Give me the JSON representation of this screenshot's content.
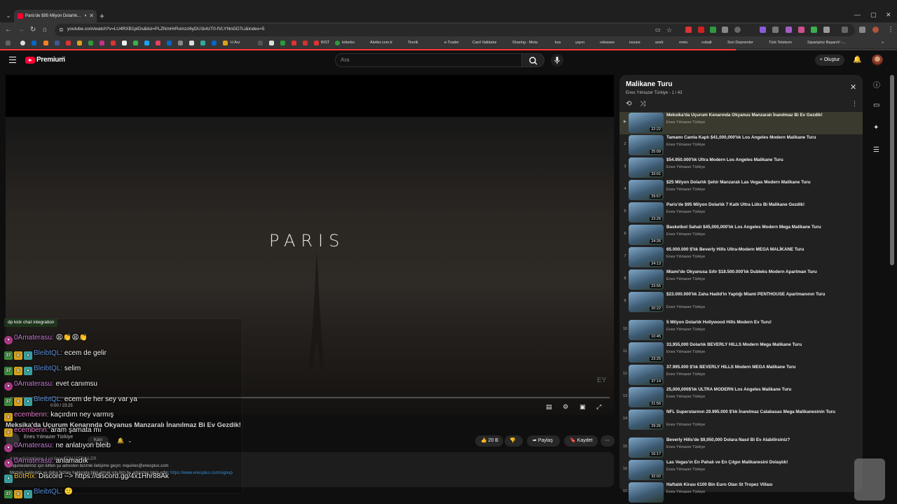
{
  "browser": {
    "tab_title": "Paris'de $95 Milyon Dolarlık...",
    "url": "youtube.com/watch?v=LU4RXB1pIDs&list=PLZNmHrRomzz6yDU1k4zT0-fVLYNnGD7Li&index=5",
    "bookmarks": [
      "H Arz",
      "BIST",
      "letterbx",
      "Aletler.com.tr",
      "Teorik",
      "e-Trader",
      "Card Validator",
      "Sharing - Meta",
      "kss",
      "yayın",
      "releases",
      "issues",
      "work",
      "mmo",
      "cobalt",
      "Son Depremler",
      "Türk Telekom",
      "Siparişiniz Başarılı! -..."
    ]
  },
  "header": {
    "brand": "Premium",
    "country": "TR",
    "search_placeholder": "Ara",
    "create_label": "Oluştur"
  },
  "video": {
    "overlay_title": "PARIS",
    "time": "0:00 / 23:25",
    "watermark": "EY"
  },
  "chat": {
    "header": "dp kick chat integration",
    "messages": [
      {
        "user": "0Amaterasu:",
        "text": "😩👏😩👏",
        "color": "#c77bd6",
        "badges": [
          "p"
        ],
        "id": 0
      },
      {
        "user": "BleibtQL:",
        "text": "ecem de gelir",
        "color": "#5b8fd6",
        "badges": [
          "k",
          "y",
          "g"
        ],
        "id": 1
      },
      {
        "user": "BleibtQL:",
        "text": "selim",
        "color": "#5b8fd6",
        "badges": [
          "k",
          "y",
          "g"
        ],
        "id": 2
      },
      {
        "user": "0Amaterasu:",
        "text": "evet canımsu",
        "color": "#c77bd6",
        "badges": [
          "p"
        ],
        "id": 3
      },
      {
        "user": "BleibtQL:",
        "text": "ecem de her sey var ya",
        "color": "#5b8fd6",
        "badges": [
          "k",
          "y",
          "g"
        ],
        "id": 4
      },
      {
        "user": "ecembenn:",
        "text": "kaçırdım ney varmış",
        "color": "#e07cc5",
        "badges": [
          "y"
        ],
        "id": 5
      },
      {
        "user": "ecembenn:",
        "text": "aram şamata mı",
        "color": "#e07cc5",
        "badges": [
          "y"
        ],
        "id": 6
      },
      {
        "user": "0Amaterasu:",
        "text": "ne anlatıyon bleib",
        "color": "#c77bd6",
        "badges": [
          "p"
        ],
        "id": 7
      },
      {
        "user": "0Amaterasu:",
        "text": "anlamadık",
        "color": "#c77bd6",
        "badges": [
          "p"
        ],
        "id": 8
      },
      {
        "user": "BotRix:",
        "text": "Discord --> https://discord.gg/4x1Hhr88Ak",
        "color": "#f0c040",
        "badges": [
          "g"
        ],
        "id": 9
      },
      {
        "user": "BleibtQL:",
        "text": "🙂",
        "color": "#5b8fd6",
        "badges": [
          "k",
          "y",
          "g"
        ],
        "id": 10
      }
    ]
  },
  "watch": {
    "title": "Meksika'da Uçurum Kenarında Okyanus Manzaralı İnanılmaz Bi Ev Gezdik!",
    "channel": "Enes Yılmazer Türkiye",
    "join": "Katıl",
    "likes": "20 B",
    "share": "Paylaş",
    "save": "Kaydet",
    "desc_line1": "4 Mn görüntüleme  4 yıl önce  TÜM İÇERİKLER",
    "desc_line2": "inquiriesleriniz için lütfen şu adresten bizimle iletişime geçin: inquiries@enesplus.com",
    "desc_line3": "Mortals hakkında ve daha fazlası hakkında bilgi almak için bizi bu adresten takip edin: ",
    "desc_link": "https://www.enesplus.com/signup"
  },
  "playlist": {
    "title": "Malikane Turu",
    "subtitle": "Enes Yılmazer Türkiye - 1 / 43",
    "items": [
      {
        "idx": "▶",
        "title": "Meksika'da Uçurum Kenarında Okyanus Manzaralı İnanılmaz Bi Ev Gezdik!",
        "channel": "Enes Yılmazer Türkiye",
        "duration": "22:22"
      },
      {
        "idx": "2",
        "title": "Tamamı Camla Kaplı $41,000,000'lık Los Angeles Modern Malikane Turu",
        "channel": "Enes Yılmazer Türkiye",
        "duration": "25:09"
      },
      {
        "idx": "3",
        "title": "$54.950.000'lık Ultra Modern Los Angeles Malikane Turu",
        "channel": "Enes Yılmazer Türkiye",
        "duration": "33:01"
      },
      {
        "idx": "4",
        "title": "$25 Milyon Dolarlık Şehir Manzaralı Las Vegas Modern Malikane Turu",
        "channel": "Enes Yılmazer Türkiye",
        "duration": "29:57"
      },
      {
        "idx": "5",
        "title": "Paris'de $95 Milyon Dolarlık 7 Katlı Ultra Lüks Bi Malikane Gezdik!",
        "channel": "Enes Yılmazer Türkiye",
        "duration": "23:26"
      },
      {
        "idx": "6",
        "title": "Basketbol Sahalı $45,000,000'lık Los Angeles Modern Mega Malikane Turu",
        "channel": "Enes Yılmazer Türkiye",
        "duration": "24:26"
      },
      {
        "idx": "7",
        "title": "65.000.000 $'lık Beverly Hills Ultra-Modern MEGA MALİKANE Turu",
        "channel": "Enes Yılmazer Türkiye",
        "duration": "24:13"
      },
      {
        "idx": "8",
        "title": "Miami'de Okyanusa Sıfır $18.500.000'lık Dubleks Modern Apartman Turu",
        "channel": "Enes Yılmazer Türkiye",
        "duration": "23:55"
      },
      {
        "idx": "9",
        "title": "$23.000.000'lık Zaha Hadid'in Yaptığı Miami PENTHOUSE Apartmanının Turu",
        "channel": "Enes Yılmazer Türkiye",
        "duration": "20:22"
      },
      {
        "idx": "10",
        "title": "5 Milyon Dolarlık Hollywood Hills Modern Ev Turu!",
        "channel": "Enes Yılmazer Türkiye",
        "duration": "10:45"
      },
      {
        "idx": "11",
        "title": "33,955,000 Dolarlık BEVERLY HILLS Modern Mega Malikane Turu",
        "channel": "Enes Yılmazer Türkiye",
        "duration": "23:25"
      },
      {
        "idx": "12",
        "title": "37.995.000 $'lık BEVERLY HILLS Modern MEGA Malikane Turu",
        "channel": "Enes Yılmazer Türkiye",
        "duration": "37:14"
      },
      {
        "idx": "13",
        "title": "25,000,000$'lık ULTRA MODERN Los Angeles Malikane Turu",
        "channel": "Enes Yılmazer Türkiye",
        "duration": "21:50"
      },
      {
        "idx": "14",
        "title": "NFL Superstarının 29.995.000 $'lık İnanılmaz Calabasas Mega Malikanesinin Turu",
        "channel": "Enes Yılmazer Türkiye",
        "duration": "29:26"
      },
      {
        "idx": "15",
        "title": "Beverly Hills'de $9,950,000 Dolara Nasıl Bi Ev Alabilirsiniz?",
        "channel": "Enes Yılmazer Türkiye",
        "duration": "16:17"
      },
      {
        "idx": "16",
        "title": "Las Vegas'ın En Pahalı ve En Çılgın Malikanesini Dolaştık!",
        "channel": "Enes Yılmazer Türkiye",
        "duration": "32:02"
      },
      {
        "idx": "17",
        "title": "Haftalık Kirası €100 Bin Euro Olan St Tropez Villası",
        "channel": "Enes Yılmazer Türkiye",
        "duration": ""
      }
    ]
  },
  "colors": {
    "accent": "#ff0033",
    "link": "#3ea6ff"
  }
}
